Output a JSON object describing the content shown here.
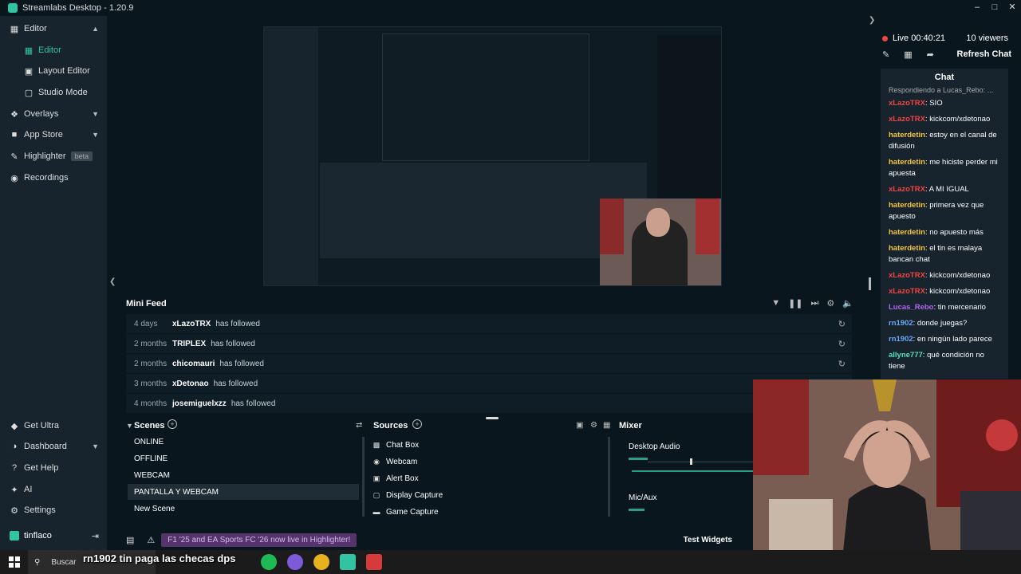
{
  "window": {
    "title": "Streamlabs Desktop - 1.20.9"
  },
  "sidebar": {
    "items": [
      {
        "label": "Editor",
        "icon": "editor-icon"
      },
      {
        "label": "Editor",
        "icon": "editor-icon"
      },
      {
        "label": "Layout Editor",
        "icon": "layout-icon"
      },
      {
        "label": "Studio Mode",
        "icon": "studio-icon"
      },
      {
        "label": "Overlays",
        "icon": "overlays-icon"
      },
      {
        "label": "App Store",
        "icon": "store-icon"
      },
      {
        "label": "Highlighter",
        "icon": "highlighter-icon",
        "badge": "beta"
      },
      {
        "label": "Recordings",
        "icon": "recordings-icon"
      }
    ],
    "bottom_items": [
      {
        "label": "Get Ultra"
      },
      {
        "label": "Dashboard"
      },
      {
        "label": "Get Help"
      },
      {
        "label": "AI"
      },
      {
        "label": "Settings"
      }
    ],
    "user": "tinflaco"
  },
  "minifeed": {
    "title": "Mini Feed",
    "rows": [
      {
        "age": "4 days",
        "user": "xLazoTRX",
        "action": "has followed"
      },
      {
        "age": "2 months",
        "user": "TRIPLEX",
        "action": "has followed"
      },
      {
        "age": "2 months",
        "user": "chicomauri",
        "action": "has followed"
      },
      {
        "age": "3 months",
        "user": "xDetonao",
        "action": "has followed"
      },
      {
        "age": "4 months",
        "user": "josemiguelxzz",
        "action": "has followed"
      }
    ]
  },
  "scenes": {
    "title": "Scenes",
    "items": [
      "ONLINE",
      "OFFLINE",
      "WEBCAM",
      "PANTALLA Y WEBCAM",
      "New Scene"
    ],
    "active_index": 3
  },
  "sources": {
    "title": "Sources",
    "items": [
      "Chat Box",
      "Webcam",
      "Alert Box",
      "Display Capture",
      "Game Capture"
    ]
  },
  "mixer": {
    "title": "Mixer",
    "channels": [
      {
        "label": "Desktop Audio"
      },
      {
        "label": "Mic/Aux"
      }
    ]
  },
  "statusbar": {
    "notification": "F1 '25 and EA Sports FC '26 now live in Highlighter!",
    "test_widgets": "Test Widgets"
  },
  "chat": {
    "live": "Live 00:40:21",
    "viewers": "10 viewers",
    "refresh": "Refresh Chat",
    "header": "Chat",
    "reply_hint": "Respondiendo a Lucas_Rebo: ...",
    "messages": [
      {
        "user": "xLazoTRX",
        "text": ": SIO",
        "color": "#f04545"
      },
      {
        "user": "xLazoTRX",
        "text": ": kickcom/xdetonao",
        "color": "#f04545"
      },
      {
        "user": "haterdetin",
        "text": ": estoy en el canal de difusión",
        "color": "#f5c542"
      },
      {
        "user": "haterdetin",
        "text": ": me hiciste perder mi apuesta",
        "color": "#f5c542"
      },
      {
        "user": "xLazoTRX",
        "text": ": A MI IGUAL",
        "color": "#f04545"
      },
      {
        "user": "haterdetin",
        "text": ": primera vez que apuesto",
        "color": "#f5c542"
      },
      {
        "user": "haterdetin",
        "text": ": no apuesto más",
        "color": "#f5c542"
      },
      {
        "user": "haterdetin",
        "text": ": el tin es malaya bancan chat",
        "color": "#f5c542"
      },
      {
        "user": "xLazoTRX",
        "text": ": kickcom/xdetonao",
        "color": "#f04545"
      },
      {
        "user": "xLazoTRX",
        "text": ": kickcom/xdetonao",
        "color": "#f04545"
      },
      {
        "user": "Lucas_Rebo",
        "text": ": tin mercenario",
        "color": "#b067f0"
      },
      {
        "user": "rn1902",
        "text": ": donde juegas?",
        "color": "#6aa9f5"
      },
      {
        "user": "rn1902",
        "text": ": en ningún lado parece",
        "color": "#6aa9f5"
      },
      {
        "user": "allyne777",
        "text": ": qué condición no tiene",
        "color": "#5be0b6"
      }
    ]
  },
  "taskbar": {
    "search": "Buscar",
    "caption": "rn1902  tin paga las checas dps"
  }
}
